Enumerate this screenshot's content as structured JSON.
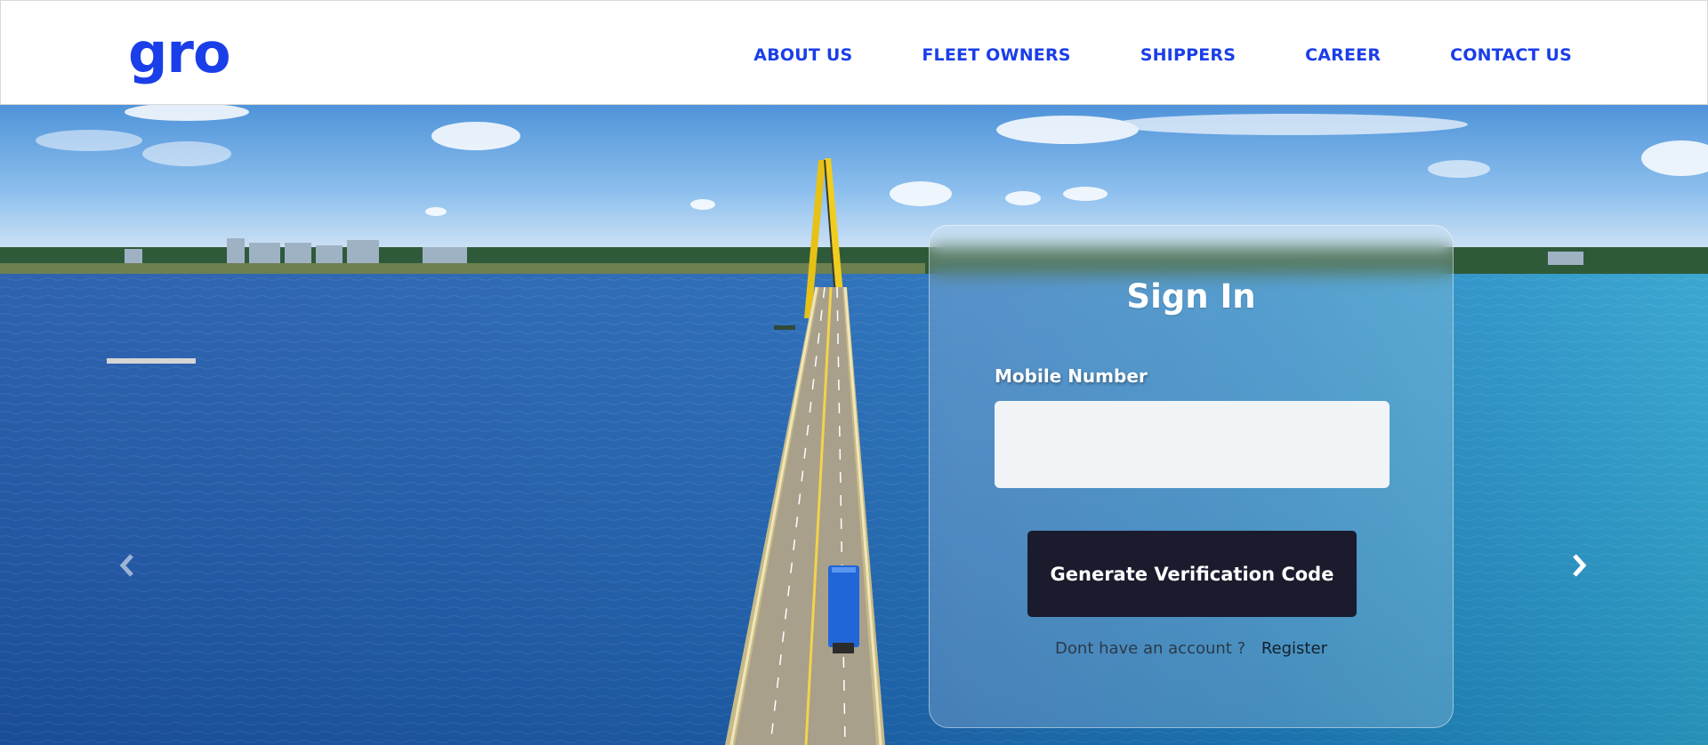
{
  "header": {
    "logo_text": "gro",
    "nav": [
      {
        "label": "ABOUT US"
      },
      {
        "label": "FLEET OWNERS"
      },
      {
        "label": "SHIPPERS"
      },
      {
        "label": "CAREER"
      },
      {
        "label": "CONTACT US"
      }
    ]
  },
  "hero": {
    "image_icon": "bridge-over-river-photo",
    "prev_icon": "chevron-left-icon",
    "next_icon": "chevron-right-icon"
  },
  "signin": {
    "title": "Sign In",
    "mobile_label": "Mobile Number",
    "mobile_value": "",
    "mobile_placeholder": "",
    "button_label": "Generate Verification Code",
    "register_prompt": "Dont have an account ?",
    "register_link": "Register"
  },
  "colors": {
    "brand": "#1a3ee8",
    "button_bg": "#1b1b2e",
    "input_bg": "#f1f4f7"
  }
}
